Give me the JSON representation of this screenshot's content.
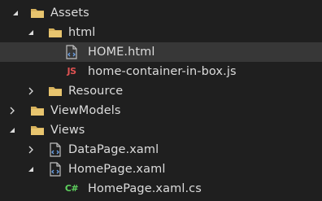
{
  "tree": {
    "items": [
      {
        "label": "Assets",
        "icon": "folder-icon"
      },
      {
        "label": "html",
        "icon": "folder-icon"
      },
      {
        "label": "HOME.html",
        "icon": "html-file-icon"
      },
      {
        "label": "home-container-in-box.js",
        "icon": "js-file-icon",
        "badge": "JS"
      },
      {
        "label": "Resource",
        "icon": "folder-icon"
      },
      {
        "label": "ViewModels",
        "icon": "folder-icon"
      },
      {
        "label": "Views",
        "icon": "folder-icon"
      },
      {
        "label": "DataPage.xaml",
        "icon": "xaml-file-icon"
      },
      {
        "label": "HomePage.xaml",
        "icon": "xaml-file-icon"
      },
      {
        "label": "HomePage.xaml.cs",
        "icon": "csharp-file-icon",
        "badge": "C#"
      }
    ]
  },
  "colors": {
    "background": "#1f1f1f",
    "selected_row": "#373737",
    "text": "#dcdcdc",
    "folder": "#d7b25d",
    "js": "#e05252",
    "csharp": "#5fd35f"
  }
}
